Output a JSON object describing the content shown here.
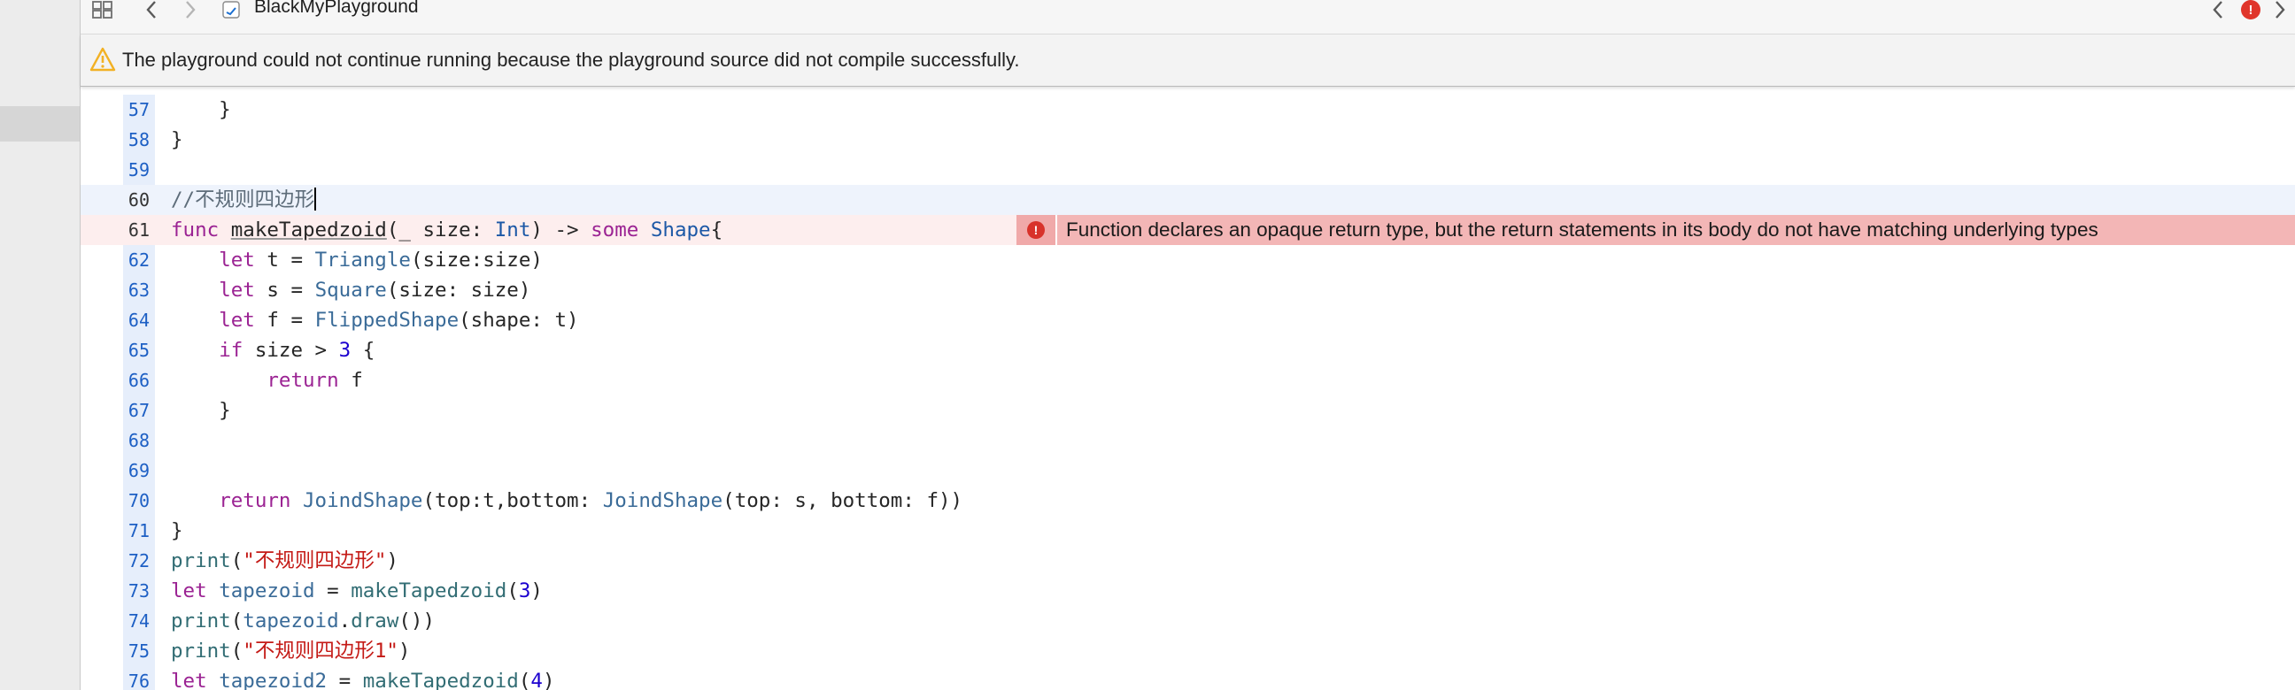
{
  "toolbar": {
    "title": "BlackMyPlayground",
    "icons": [
      "grid-icon",
      "chevron-left-icon",
      "chevron-right-icon",
      "swift-file-icon",
      "error-badge-icon",
      "inspector-icon"
    ],
    "issue_count": "!"
  },
  "banner": {
    "text": "The playground could not continue running because the playground source did not compile successfully.",
    "icon": "warning-triangle-icon",
    "icon_color": "#f2b124"
  },
  "editor": {
    "lines": [
      {
        "num": "57",
        "code": "    }"
      },
      {
        "num": "58",
        "code": "}"
      },
      {
        "num": "59",
        "code": ""
      },
      {
        "num": "60",
        "code": "//不规则四边形"
      },
      {
        "num": "61",
        "code": "func makeTapedzoid(_ size: Int) -> some Shape{"
      },
      {
        "num": "62",
        "code": "    let t = Triangle(size:size)"
      },
      {
        "num": "63",
        "code": "    let s = Square(size: size)"
      },
      {
        "num": "64",
        "code": "    let f = FlippedShape(shape: t)"
      },
      {
        "num": "65",
        "code": "    if size > 3 {"
      },
      {
        "num": "66",
        "code": "        return f"
      },
      {
        "num": "67",
        "code": "    }"
      },
      {
        "num": "68",
        "code": ""
      },
      {
        "num": "69",
        "code": ""
      },
      {
        "num": "70",
        "code": "    return JoindShape(top:t,bottom: JoindShape(top: s, bottom: f))"
      },
      {
        "num": "71",
        "code": "}"
      },
      {
        "num": "72",
        "code": "print(\"不规则四边形\")"
      },
      {
        "num": "73",
        "code": "let tapezoid = makeTapedzoid(3)"
      },
      {
        "num": "74",
        "code": "print(tapezoid.draw())"
      },
      {
        "num": "75",
        "code": "print(\"不规则四边形1\")"
      },
      {
        "num": "76",
        "code": "let tapezoid2 = makeTapedzoid(4)"
      }
    ],
    "current_line": "60",
    "error_line": "61",
    "inline_error": {
      "icon": "error-circle-icon",
      "text": "Function declares an opaque return type, but the return statements in its body do not have matching underlying types",
      "color": "#f3b6b6"
    }
  }
}
